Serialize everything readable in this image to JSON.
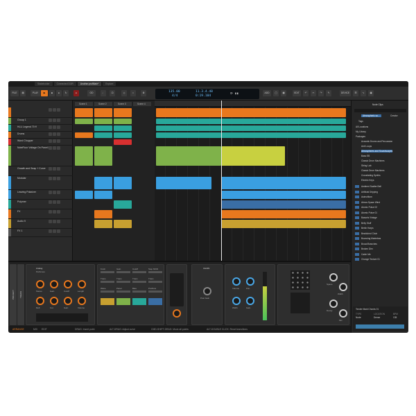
{
  "tabs": [
    "Stakeholder",
    "Connected DOR",
    "Another.profMain*",
    "Explore"
  ],
  "toolbar": {
    "file": "FILE",
    "play": "PLAY",
    "add": "ADD",
    "edit": "EDIT",
    "device": "DEVICE"
  },
  "display": {
    "tempo": "135.00",
    "signature": "4/4",
    "position": "11.3.4.48",
    "time": "0:19.104"
  },
  "browser": {
    "title": "Node Clips",
    "search": "Atmospheric so...",
    "creator": "Creator",
    "tags": "Tags",
    "locations": [
      "All Locations",
      "My Library",
      "Packages",
      "Acoustic Drums and Percussion",
      "Anti Loops",
      "Atmospheres and Soundscapes",
      "Bass EB",
      "Classic Drum Machines",
      "String Lab",
      "Classic Drum Machines",
      "Crossfading Synths",
      "Electric Keys"
    ],
    "results": [
      "Ambient Scatter Bell",
      "Artificial Dripping",
      "Asimuftiom",
      "Atmos Space Wind",
      "Atomic Pulse 02",
      "Atomic Pulse 01",
      "Bassels Vintage",
      "Belly Stuff",
      "Berlin Harps",
      "Bewitched Choir",
      "Bouncing Marimbas",
      "Broad Branches",
      "Broken Dim",
      "Catch Me",
      "Change Texture 01"
    ],
    "preview": "Tender Maid Chords 01",
    "preview_labels": [
      "TYPE",
      "LOCATION",
      "BPM",
      "Node",
      "Dense",
      "135"
    ]
  },
  "tracks": [
    {
      "name": "",
      "color": "#e8781e"
    },
    {
      "name": "Group 1",
      "color": "#7fb24a"
    },
    {
      "name": "Hi-Li Legend 70 ff",
      "color": "#28a89a"
    },
    {
      "name": "Drums",
      "color": "#e8781e"
    },
    {
      "name": "Word Chopper",
      "color": "#d83030"
    },
    {
      "name": "NoteFloor Voltage On Panel FB 01",
      "color": "#7fb24a"
    },
    {
      "name": "Growth and Snap + Curve",
      "color": "#2a2a2a"
    },
    {
      "name": "Modular",
      "color": "#3a9fe0"
    },
    {
      "name": "Leaving Polarizer",
      "color": "#3a9fe0"
    },
    {
      "name": "Polymer",
      "color": "#28a89a"
    },
    {
      "name": "FX",
      "color": "#e8781e"
    },
    {
      "name": "Audio 9",
      "color": "#c8a030"
    },
    {
      "name": "FX 1",
      "color": "#555"
    }
  ],
  "scenes": [
    "Scene 1",
    "Scene 2",
    "Scene 3",
    "Scene 4"
  ],
  "devices": {
    "preset": "Analog",
    "sub": "Perfumes",
    "knobs": [
      "Stereo",
      "Gain",
      "Cutoff",
      "Length",
      "Refl",
      "Cut",
      "Gain",
      "Volume"
    ],
    "modulator": [
      "Knob",
      "Gain",
      "Cutoff",
      "Step MOD",
      "Trans",
      "Trans",
      "Trans",
      "Trans",
      "Wave",
      "Panel",
      "Bias",
      "PreFlow"
    ],
    "comp": "CHAIN",
    "comp_knobs": [
      "Post Gain"
    ],
    "eq": [
      "Volume",
      "Pan",
      "Width",
      "Gain"
    ],
    "side": [
      "Space",
      "Width",
      "Decay",
      "Mix"
    ]
  },
  "status": [
    "ARRANGE",
    "MIX",
    "EDIT",
    "DRAG: Insert point",
    "ALT-DRAG: Adjust curve",
    "CMD-SHIFT-DRAG: Move all points",
    "ALT-DOUBLE CLICK: Reset transitions"
  ]
}
